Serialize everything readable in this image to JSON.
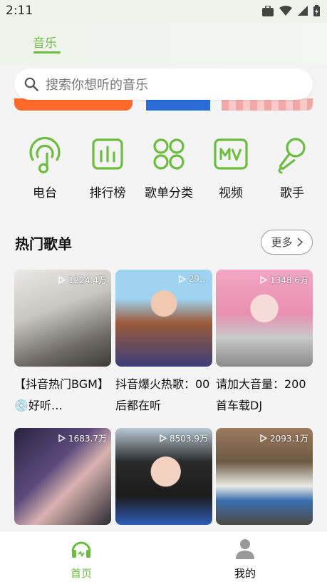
{
  "status_bar": {
    "time": "2:11"
  },
  "header": {
    "tab_label": "音乐"
  },
  "search": {
    "placeholder": "搜索你想听的音乐"
  },
  "categories": [
    {
      "label": "电台",
      "icon": "radio-icon"
    },
    {
      "label": "排行榜",
      "icon": "chart-icon"
    },
    {
      "label": "歌单分类",
      "icon": "grid-icon"
    },
    {
      "label": "视频",
      "icon": "mv-icon"
    },
    {
      "label": "歌手",
      "icon": "microphone-icon"
    }
  ],
  "hot_playlists": {
    "title": "热门歌单",
    "more_label": "更多",
    "items": [
      {
        "plays": "1224.4万",
        "title": "【抖音热门BGM】💿好听…"
      },
      {
        "plays": "29…",
        "title": "抖音爆火热歌：00后都在听"
      },
      {
        "plays": "1348.6万",
        "title": "请加大音量：200首车载DJ"
      },
      {
        "plays": "1683.7万",
        "title": ""
      },
      {
        "plays": "8503.9万",
        "title": ""
      },
      {
        "plays": "2093.1万",
        "title": ""
      }
    ]
  },
  "bottom_nav": {
    "home_label": "首页",
    "mine_label": "我的"
  },
  "colors": {
    "accent": "#6cbd3f"
  }
}
